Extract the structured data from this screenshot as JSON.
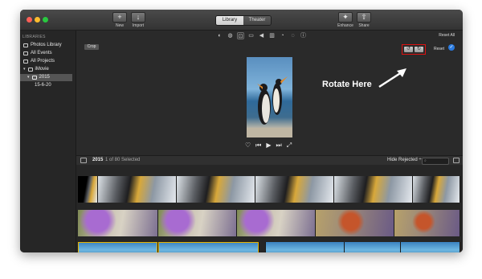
{
  "toolbar": {
    "new_label": "New",
    "import_label": "Import",
    "enhance_label": "Enhance",
    "share_label": "Share",
    "tabs": [
      {
        "label": "Library",
        "active": true
      },
      {
        "label": "Theater",
        "active": false
      }
    ]
  },
  "sidebar": {
    "header": "LIBRARIES",
    "items": [
      {
        "label": "Photos Library",
        "icon": "photos-icon"
      },
      {
        "label": "All Events",
        "icon": "events-icon"
      },
      {
        "label": "All Projects",
        "icon": "projects-icon"
      },
      {
        "label": "iMovie",
        "icon": "imovie-icon"
      },
      {
        "label": "2015",
        "icon": "folder-icon",
        "selected": true
      },
      {
        "label": "15-6-20",
        "icon": ""
      }
    ]
  },
  "viewer": {
    "reset_all": "Reset All",
    "crop_label": "Crop",
    "reset_label": "Reset",
    "annotation": "Rotate Here",
    "tools": [
      "color-balance-icon",
      "color-correction-icon",
      "crop-icon",
      "stabilization-icon",
      "volume-icon",
      "equalizer-icon",
      "speed-icon",
      "noise-reduction-icon",
      "info-icon"
    ]
  },
  "browser": {
    "year": "2015",
    "selection": "1 of 80 Selected",
    "filter": "Hide Rejected ÷",
    "search_placeholder": ""
  },
  "colors": {
    "window_bg": "#2b2b2b",
    "accent_blue": "#2a7be0",
    "selection_yellow": "#e5b400",
    "annotation_red": "#d11111"
  }
}
